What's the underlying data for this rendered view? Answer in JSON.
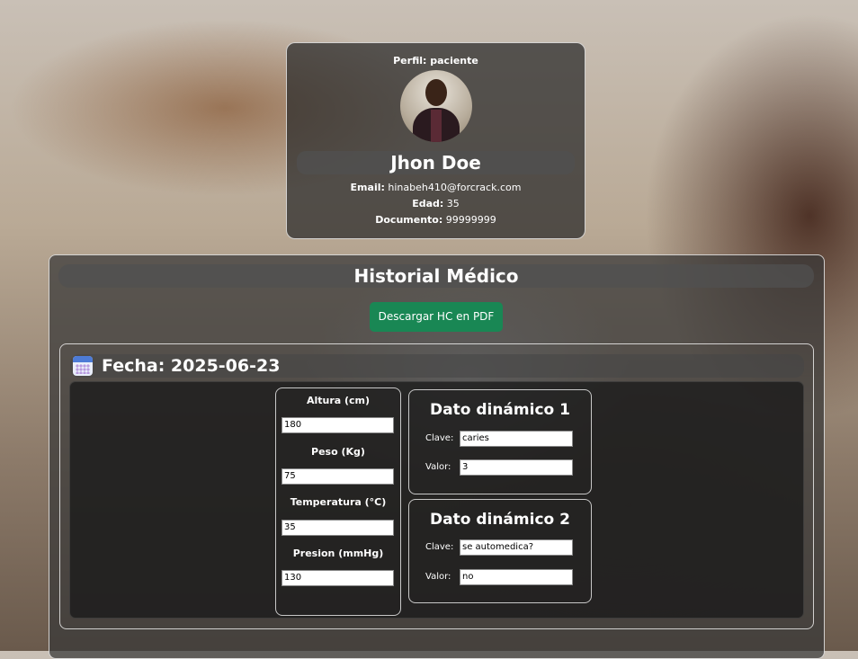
{
  "profile": {
    "perfil_label": "Perfil:",
    "perfil_value": "paciente",
    "name": "Jhon Doe",
    "email_label": "Email:",
    "email_value": "hinabeh410@forcrack.com",
    "edad_label": "Edad:",
    "edad_value": "35",
    "documento_label": "Documento:",
    "documento_value": "99999999"
  },
  "history": {
    "title": "Historial Médico",
    "download_button": "Descargar HC en PDF",
    "entry": {
      "date_label": "Fecha: 2025-06-23",
      "vitals": [
        {
          "label": "Altura (cm)",
          "value": "180"
        },
        {
          "label": "Peso (Kg)",
          "value": "75"
        },
        {
          "label": "Temperatura (°C)",
          "value": "35"
        },
        {
          "label": "Presion (mmHg)",
          "value": "130"
        }
      ],
      "dynamic": [
        {
          "title": "Dato dinámico 1",
          "clave_label": "Clave:",
          "clave": "caries",
          "valor_label": "Valor:",
          "valor": "3"
        },
        {
          "title": "Dato dinámico 2",
          "clave_label": "Clave:",
          "clave": "se automedica?",
          "valor_label": "Valor:",
          "valor": "no"
        }
      ]
    }
  },
  "icons": {
    "calendar": "calendar-icon"
  },
  "colors": {
    "download_button": "#198754"
  }
}
